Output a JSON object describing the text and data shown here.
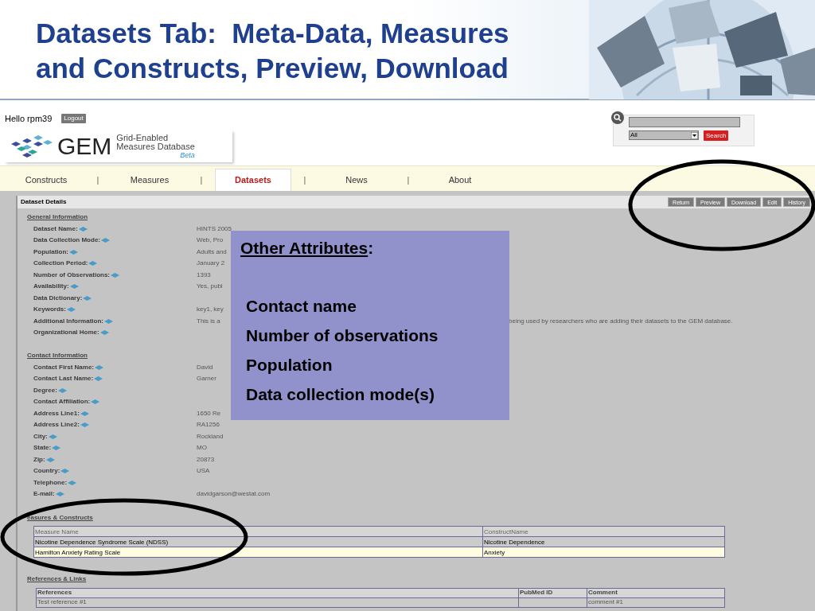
{
  "slide": {
    "title_lines": [
      "Datasets Tab:  Meta-Data, Measures",
      "and Constructs, Preview, Download"
    ]
  },
  "header": {
    "greeting": "Hello rpm39",
    "logout": "Logout",
    "logo": {
      "wordmark": "GEM",
      "subtitle_lines": [
        "Grid-Enabled",
        "Measures Database"
      ],
      "badge": "Beta"
    }
  },
  "search": {
    "scope": "All",
    "button": "Search"
  },
  "tabs": [
    {
      "label": "Constructs",
      "selected": false,
      "separator_after": "|"
    },
    {
      "label": "Measures",
      "selected": false,
      "separator_after": "|"
    },
    {
      "label": "Datasets",
      "selected": true,
      "separator_after": "|"
    },
    {
      "label": "News",
      "selected": false,
      "separator_after": "|"
    },
    {
      "label": "About",
      "selected": false
    }
  ],
  "panel": {
    "title": "Dataset Details",
    "buttons": [
      "Return",
      "Preview",
      "Download",
      "Edit",
      "History"
    ]
  },
  "sections": [
    {
      "heading": "General Information",
      "fields": [
        {
          "label": "Dataset Name:",
          "value": "HINTS 2005"
        },
        {
          "label": "Data Collection Mode:",
          "value": "Web, Pro"
        },
        {
          "label": "Population:",
          "value": "Adults and"
        },
        {
          "label": "Collection Period:",
          "value": "January 2"
        },
        {
          "label": "Number of Observations:",
          "value": "1393"
        },
        {
          "label": "Availability:",
          "value": "Yes, publ"
        },
        {
          "label": "Data Dictionary:"
        },
        {
          "label": "Keywords:",
          "value": "key1, key"
        },
        {
          "label": "Additional Information:",
          "value": "This is a",
          "value_tail": "being used by researchers who are adding their datasets to the GEM database."
        },
        {
          "label": "Organizational Home:"
        }
      ]
    },
    {
      "heading": "Contact Information",
      "fields": [
        {
          "label": "Contact First Name:",
          "value": "David"
        },
        {
          "label": "Contact Last Name:",
          "value": "Garner"
        },
        {
          "label": "Degree:"
        },
        {
          "label": "Contact Affiliation:"
        },
        {
          "label": "Address Line1:",
          "value": "1650 Re"
        },
        {
          "label": "Address Line2:",
          "value": "RA1256"
        },
        {
          "label": "City:",
          "value": "Rockland"
        },
        {
          "label": "State:",
          "value": "MO"
        },
        {
          "label": "Zip:",
          "value": "20873"
        },
        {
          "label": "Country:",
          "value": "USA"
        },
        {
          "label": "Telephone:"
        },
        {
          "label": "E-mail:",
          "value": "davidgarson@westat.com"
        }
      ]
    }
  ],
  "measures": {
    "heading": "easures & Constructs",
    "columns": [
      "Measure Name",
      "ConstructName"
    ],
    "rows": [
      {
        "cells": [
          "Nicotine Dependence Syndrome Scale (NDSS)",
          "Nicotine Dependence"
        ],
        "highlighted": false
      },
      {
        "cells": [
          "Hamilton Anxiety Rating Scale",
          "Anxiety"
        ],
        "highlighted": true
      }
    ]
  },
  "references": {
    "heading": "References & Links",
    "columns": [
      "References",
      "PubMed ID",
      "Comment"
    ],
    "rows": [
      {
        "cells": [
          "Test reference #1",
          "",
          "comment #1"
        ]
      }
    ]
  },
  "callout": {
    "title": "Other Attributes",
    "title_suffix": ":",
    "items": [
      "Contact name",
      "Number of observations",
      "Population",
      "Data collection mode(s)"
    ]
  }
}
